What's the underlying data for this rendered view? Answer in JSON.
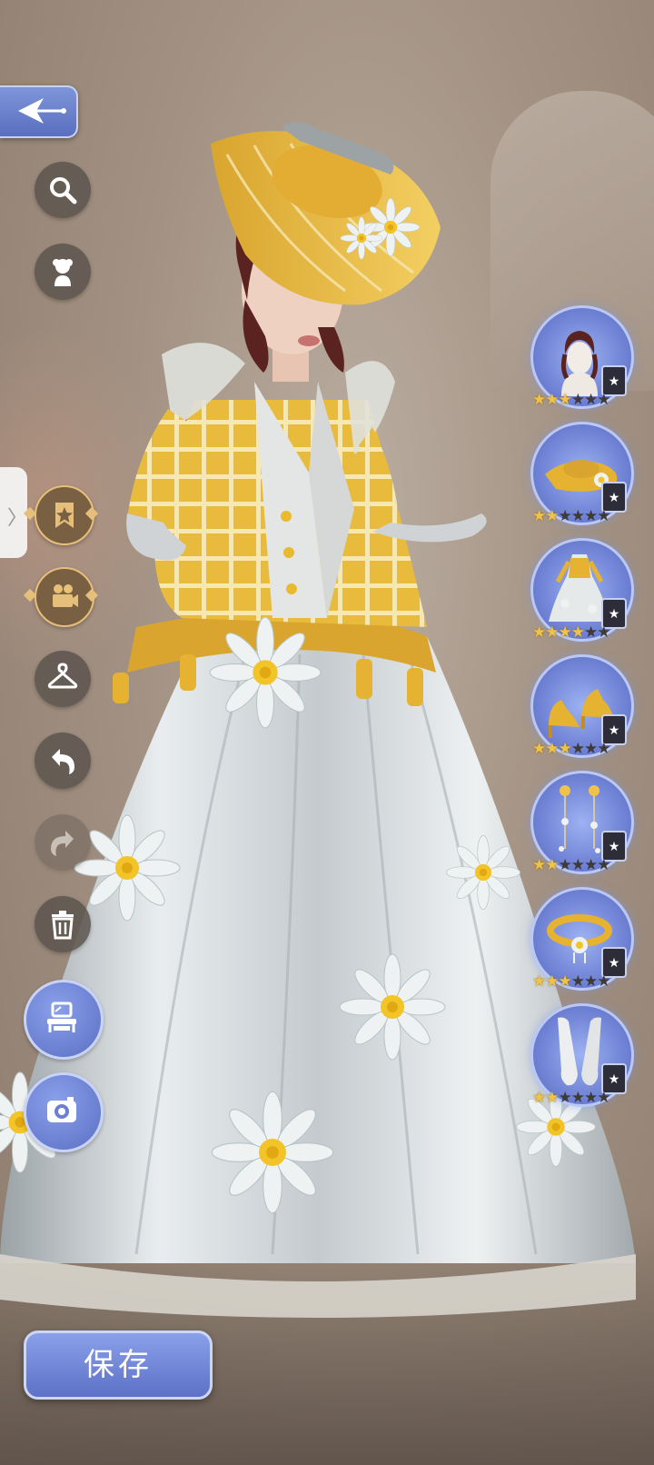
{
  "save_label": "保存",
  "colors": {
    "accent": "#6b80d4",
    "gold": "#e6c07a",
    "star": "#f0c24a"
  },
  "toolbar": {
    "back_icon": "back-arrow-icon",
    "tools": [
      "search-icon",
      "character-bust-icon",
      "bookmark-star-icon",
      "video-camera-icon",
      "hanger-icon",
      "undo-icon",
      "redo-icon",
      "trash-icon",
      "furniture-icon",
      "camera-icon"
    ]
  },
  "slots": [
    {
      "name": "head-slot",
      "icon": "hair-bust-icon",
      "stars": 3,
      "max_stars": 6
    },
    {
      "name": "hat-slot",
      "icon": "hat-icon",
      "stars": 2,
      "max_stars": 6
    },
    {
      "name": "dress-slot",
      "icon": "dress-icon",
      "stars": 4,
      "max_stars": 6
    },
    {
      "name": "shoes-slot",
      "icon": "shoes-icon",
      "stars": 3,
      "max_stars": 6
    },
    {
      "name": "earrings-slot",
      "icon": "earrings-icon",
      "stars": 2,
      "max_stars": 6
    },
    {
      "name": "necklace-slot",
      "icon": "necklace-icon",
      "stars": 3,
      "max_stars": 6
    },
    {
      "name": "gloves-slot",
      "icon": "gloves-icon",
      "stars": 2,
      "max_stars": 6
    }
  ]
}
